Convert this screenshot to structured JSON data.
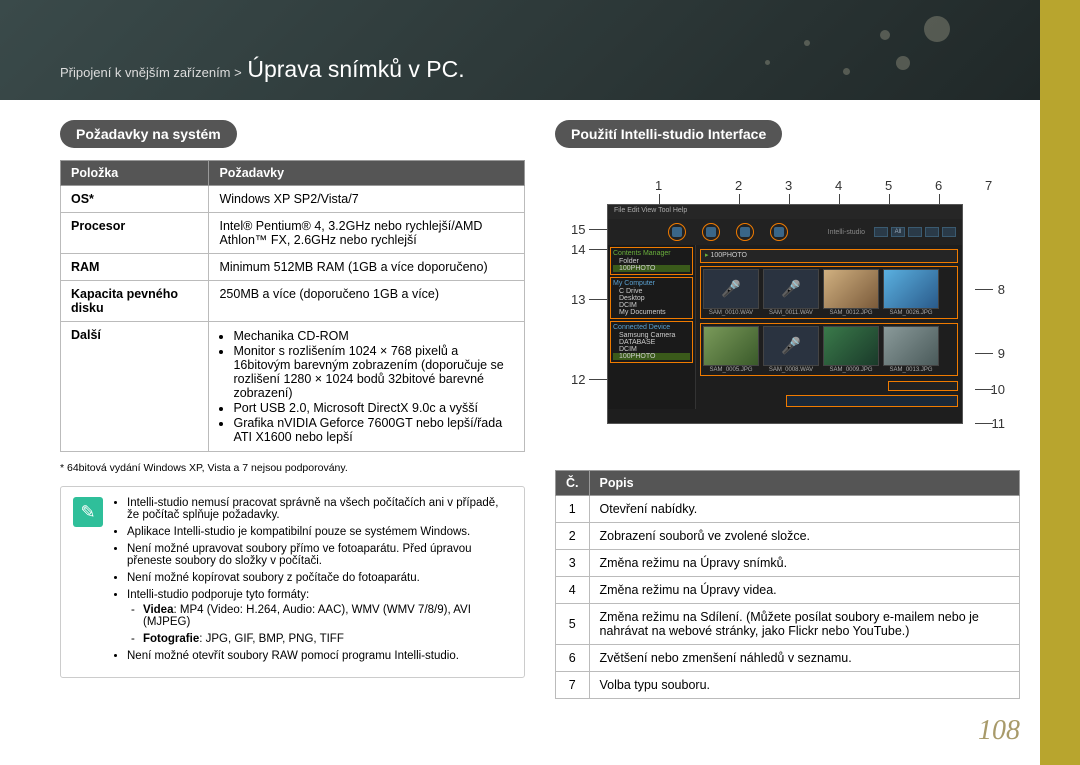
{
  "breadcrumb_prefix": "Připojení k vnějším zařízením >",
  "breadcrumb_title": "Úprava snímků v PC.",
  "left": {
    "heading": "Požadavky na systém",
    "th_item": "Položka",
    "th_req": "Požadavky",
    "rows": {
      "os_k": "OS*",
      "os_v": "Windows XP SP2/Vista/7",
      "cpu_k": "Procesor",
      "cpu_v": "Intel® Pentium® 4, 3.2GHz nebo rychlejší/AMD Athlon™ FX, 2.6GHz nebo rychlejší",
      "ram_k": "RAM",
      "ram_v": "Minimum 512MB RAM (1GB a více doporučeno)",
      "hdd_k": "Kapacita pevného disku",
      "hdd_v": "250MB a více (doporučeno 1GB a více)",
      "other_k": "Další",
      "other_b1": "Mechanika CD-ROM",
      "other_b2": "Monitor s rozlišením 1024 × 768 pixelů a 16bitovým barevným zobrazením (doporučuje se rozlišení 1280 × 1024 bodů 32bitové barevné zobrazení)",
      "other_b3": "Port USB 2.0, Microsoft DirectX 9.0c a vyšší",
      "other_b4": "Grafika nVIDIA Geforce 7600GT nebo lepší/řada ATI X1600 nebo lepší"
    },
    "footnote": "* 64bitová vydání Windows XP, Vista a 7 nejsou podporovány.",
    "notes": {
      "n1": "Intelli-studio nemusí pracovat správně na všech počítačích ani v případě, že počítač splňuje požadavky.",
      "n2": "Aplikace Intelli-studio je kompatibilní pouze se systémem Windows.",
      "n3": "Není možné upravovat soubory přímo ve fotoaparátu. Před úpravou přeneste soubory do složky v počítači.",
      "n4": "Není možné kopírovat soubory z počítače do fotoaparátu.",
      "n5": "Intelli-studio podporuje tyto formáty:",
      "n5a_label": "Videa",
      "n5a_val": ": MP4 (Video: H.264, Audio: AAC), WMV (WMV 7/8/9), AVI (MJPEG)",
      "n5b_label": "Fotografie",
      "n5b_val": ": JPG, GIF, BMP, PNG, TIFF",
      "n6": "Není možné otevřít soubory RAW pomocí programu Intelli-studio."
    }
  },
  "right": {
    "heading": "Použití Intelli-studio Interface",
    "menubar": "File  Edit  View  Tool  Help",
    "brand": "Intelli-studio",
    "tb_right_all": "All",
    "sidebar": {
      "cm_hdr": "Contents Manager",
      "cm_l1": "Folder",
      "cm_l2": "100PHOTO",
      "mc_hdr": "My Computer",
      "mc_l1": "C Drive",
      "mc_l2": "Desktop",
      "mc_l3": "DCIM",
      "mc_l4": "My Documents",
      "cd_hdr": "Connected Device",
      "cd_l1": "Samsung Camera",
      "cd_l2": "DATABASE",
      "cd_l3": "DCIM",
      "cd_l4": "100PHOTO"
    },
    "folder_bar": "100PHOTO",
    "thumbs": [
      "SAM_0010.WAV",
      "SAM_0011.WAV",
      "SAM_0012.JPG",
      "SAM_0026.JPG",
      "SAM_0005.JPG",
      "SAM_0008.WAV",
      "SAM_0009.JPG",
      "SAM_0013.JPG"
    ],
    "callouts_top": [
      "1",
      "2",
      "3",
      "4",
      "5",
      "6",
      "7"
    ],
    "callouts_left": {
      "c15": "15",
      "c14": "14",
      "c13": "13",
      "c12": "12"
    },
    "callouts_right": {
      "c8": "8",
      "c9": "9",
      "c10": "10",
      "c11": "11"
    },
    "th_num": "Č.",
    "th_desc": "Popis",
    "desc": [
      {
        "n": "1",
        "t": "Otevření nabídky."
      },
      {
        "n": "2",
        "t": "Zobrazení souborů ve zvolené složce."
      },
      {
        "n": "3",
        "t": "Změna režimu na Úpravy snímků."
      },
      {
        "n": "4",
        "t": "Změna režimu na Úpravy videa."
      },
      {
        "n": "5",
        "t": "Změna režimu na Sdílení. (Můžete posílat soubory e-mailem nebo je nahrávat na webové stránky, jako Flickr nebo YouTube.)"
      },
      {
        "n": "6",
        "t": "Zvětšení nebo zmenšení náhledů v seznamu."
      },
      {
        "n": "7",
        "t": "Volba typu souboru."
      }
    ]
  },
  "page_number": "108"
}
